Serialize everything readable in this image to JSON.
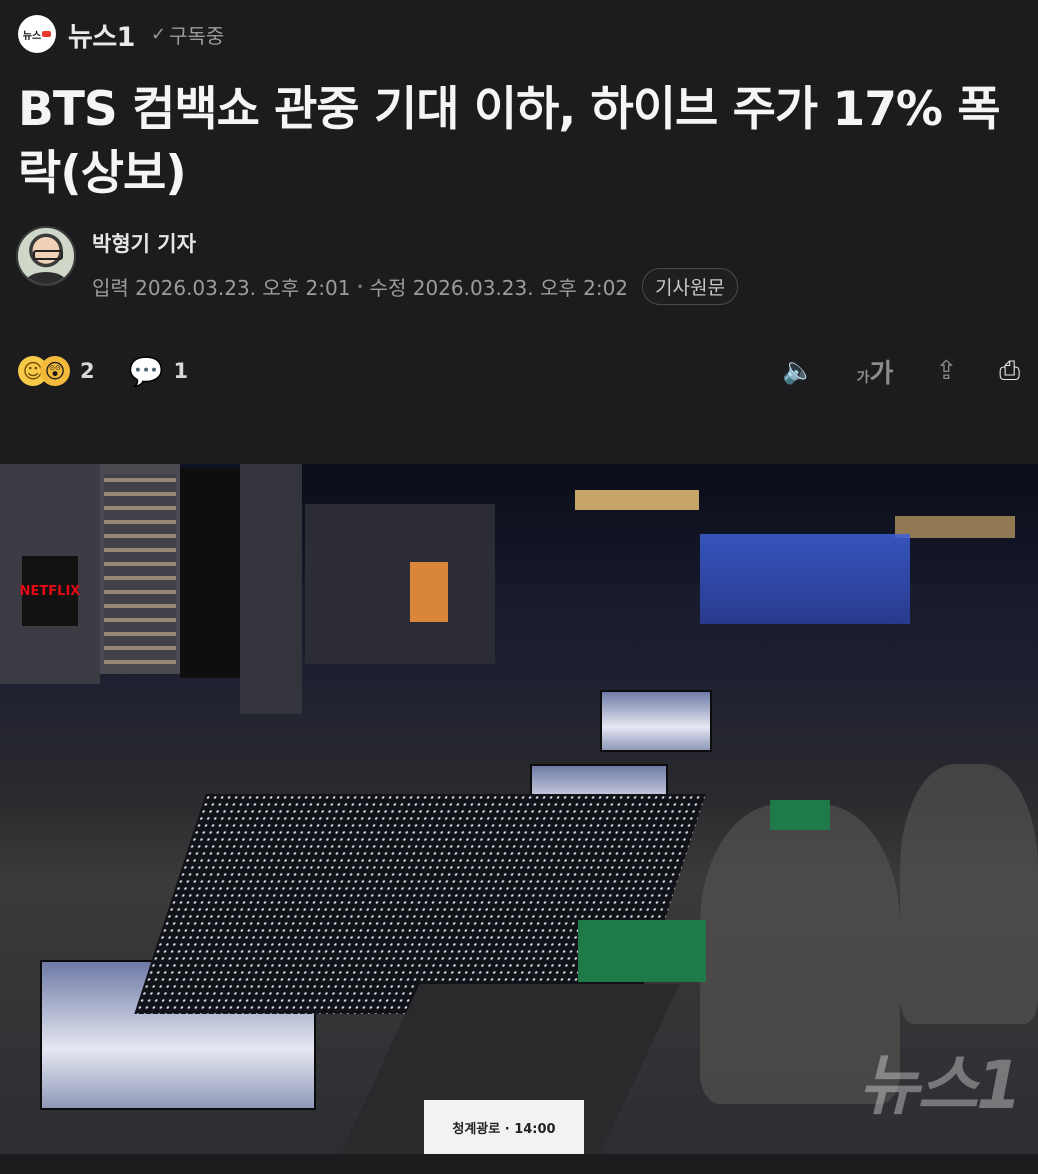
{
  "press": {
    "logo_text": "뉴스",
    "name": "뉴스1",
    "subscribed_label": "구독중"
  },
  "article": {
    "title": "BTS 컴백쇼 관중 기대 이하, 하이브 주가 17% 폭락(상보)",
    "reporter": "박형기 기자",
    "input_label": "입력",
    "input_date": "2026.03.23. 오후 2:01",
    "edit_label": "수정",
    "edit_date": "2026.03.23. 오후 2:02",
    "original_button": "기사원문"
  },
  "actions": {
    "reaction_count": "2",
    "comment_count": "1",
    "font_small": "가",
    "font_large": "가"
  },
  "photo": {
    "netflix_sign": "NETFLIX",
    "road_sign": "청계광로 · 14:00",
    "watermark": "뉴스1"
  },
  "colors": {
    "background": "#1c1c1e",
    "netflix_red": "#e50914",
    "press_accent": "#e63a2e"
  }
}
